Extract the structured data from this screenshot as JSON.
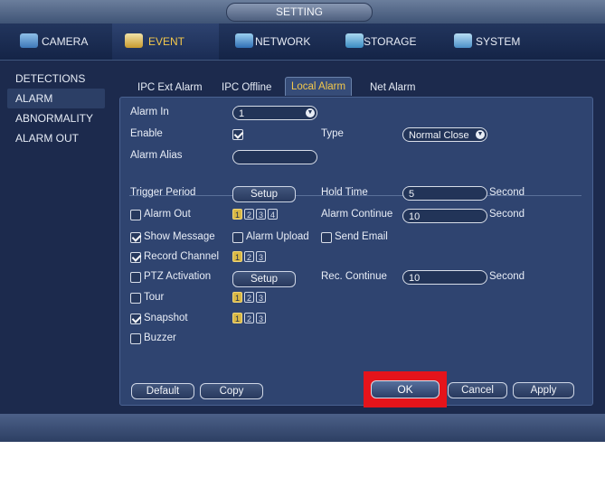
{
  "window": {
    "title": "SETTING"
  },
  "tabs": [
    {
      "label": "CAMERA",
      "icon": "camera-icon",
      "active": false
    },
    {
      "label": "EVENT",
      "icon": "event-icon",
      "active": true
    },
    {
      "label": "NETWORK",
      "icon": "network-icon",
      "active": false
    },
    {
      "label": "STORAGE",
      "icon": "storage-icon",
      "active": false
    },
    {
      "label": "SYSTEM",
      "icon": "system-icon",
      "active": false
    }
  ],
  "sidebar": {
    "items": [
      {
        "label": "DETECTIONS",
        "active": false
      },
      {
        "label": "ALARM",
        "active": true
      },
      {
        "label": "ABNORMALITY",
        "active": false
      },
      {
        "label": "ALARM OUT",
        "active": false
      }
    ]
  },
  "subtabs": [
    {
      "label": "IPC Ext Alarm",
      "active": false
    },
    {
      "label": "IPC Offline",
      "active": false
    },
    {
      "label": "Local Alarm",
      "active": true
    },
    {
      "label": "Net Alarm",
      "active": false
    }
  ],
  "form": {
    "alarm_in": {
      "label": "Alarm In",
      "value": "1"
    },
    "enable": {
      "label": "Enable",
      "checked": true
    },
    "type": {
      "label": "Type",
      "value": "Normal Close"
    },
    "alarm_alias": {
      "label": "Alarm Alias",
      "value": ""
    },
    "trigger_period": {
      "label": "Trigger Period",
      "button": "Setup"
    },
    "hold_time": {
      "label": "Hold Time",
      "value": "5",
      "unit": "Second"
    },
    "alarm_out": {
      "label": "Alarm Out",
      "checked": false,
      "channels": [
        "1",
        "2",
        "3",
        "4"
      ]
    },
    "alarm_continue": {
      "label": "Alarm Continue",
      "value": "10",
      "unit": "Second"
    },
    "show_message": {
      "label": "Show Message",
      "checked": true
    },
    "alarm_upload": {
      "label": "Alarm Upload",
      "checked": false
    },
    "send_email": {
      "label": "Send Email",
      "checked": false
    },
    "record_channel": {
      "label": "Record Channel",
      "checked": true,
      "channels": [
        "1",
        "2",
        "3"
      ]
    },
    "ptz_activation": {
      "label": "PTZ Activation",
      "checked": false,
      "button": "Setup"
    },
    "rec_continue": {
      "label": "Rec. Continue",
      "value": "10",
      "unit": "Second"
    },
    "tour": {
      "label": "Tour",
      "checked": false,
      "channels": [
        "1",
        "2",
        "3"
      ]
    },
    "snapshot": {
      "label": "Snapshot",
      "checked": true,
      "channels": [
        "1",
        "2",
        "3"
      ]
    },
    "buzzer": {
      "label": "Buzzer",
      "checked": false
    }
  },
  "footer": {
    "default": "Default",
    "copy": "Copy",
    "ok": "OK",
    "cancel": "Cancel",
    "apply": "Apply"
  },
  "colors": {
    "accent": "#f3c84b",
    "highlight": "#e5141b",
    "background": "#1c2a4d"
  }
}
